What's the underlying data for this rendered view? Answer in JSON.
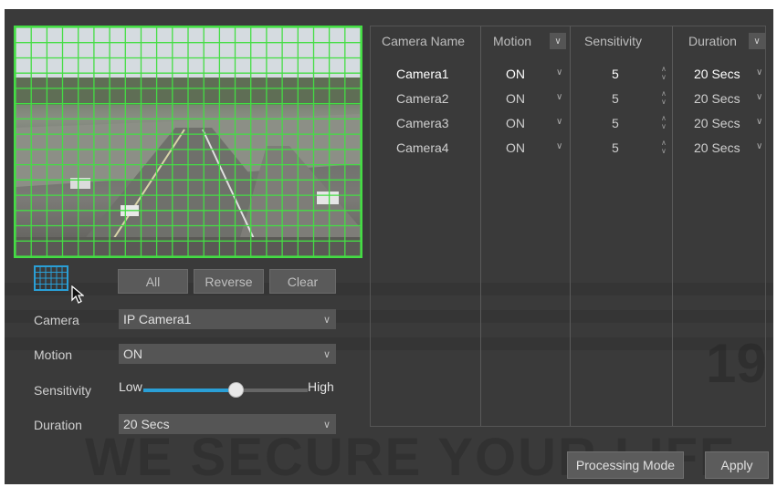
{
  "watermark": {
    "slogan": "WE SECURE YOUR LIFE",
    "number": "19"
  },
  "colors": {
    "accent": "#2a9fd6",
    "motion_grid": "#44dd44",
    "panel_bg": "#3a3a3a"
  },
  "preview": {
    "grid_icon": "motion-grid-icon"
  },
  "area_buttons": {
    "all": "All",
    "reverse": "Reverse",
    "clear": "Clear"
  },
  "form": {
    "camera": {
      "label": "Camera",
      "value": "IP Camera1"
    },
    "motion": {
      "label": "Motion",
      "value": "ON"
    },
    "sensitivity": {
      "label": "Sensitivity",
      "low": "Low",
      "high": "High",
      "level_fraction": 0.56
    },
    "duration": {
      "label": "Duration",
      "value": "20 Secs"
    }
  },
  "table": {
    "headers": {
      "camera_name": "Camera Name",
      "motion": "Motion",
      "sensitivity": "Sensitivity",
      "duration": "Duration"
    },
    "rows": [
      {
        "camera": "Camera1",
        "motion": "ON",
        "sensitivity": "5",
        "duration": "20 Secs"
      },
      {
        "camera": "Camera2",
        "motion": "ON",
        "sensitivity": "5",
        "duration": "20 Secs"
      },
      {
        "camera": "Camera3",
        "motion": "ON",
        "sensitivity": "5",
        "duration": "20 Secs"
      },
      {
        "camera": "Camera4",
        "motion": "ON",
        "sensitivity": "5",
        "duration": "20 Secs"
      }
    ]
  },
  "actions": {
    "processing_mode": "Processing Mode",
    "apply": "Apply"
  }
}
